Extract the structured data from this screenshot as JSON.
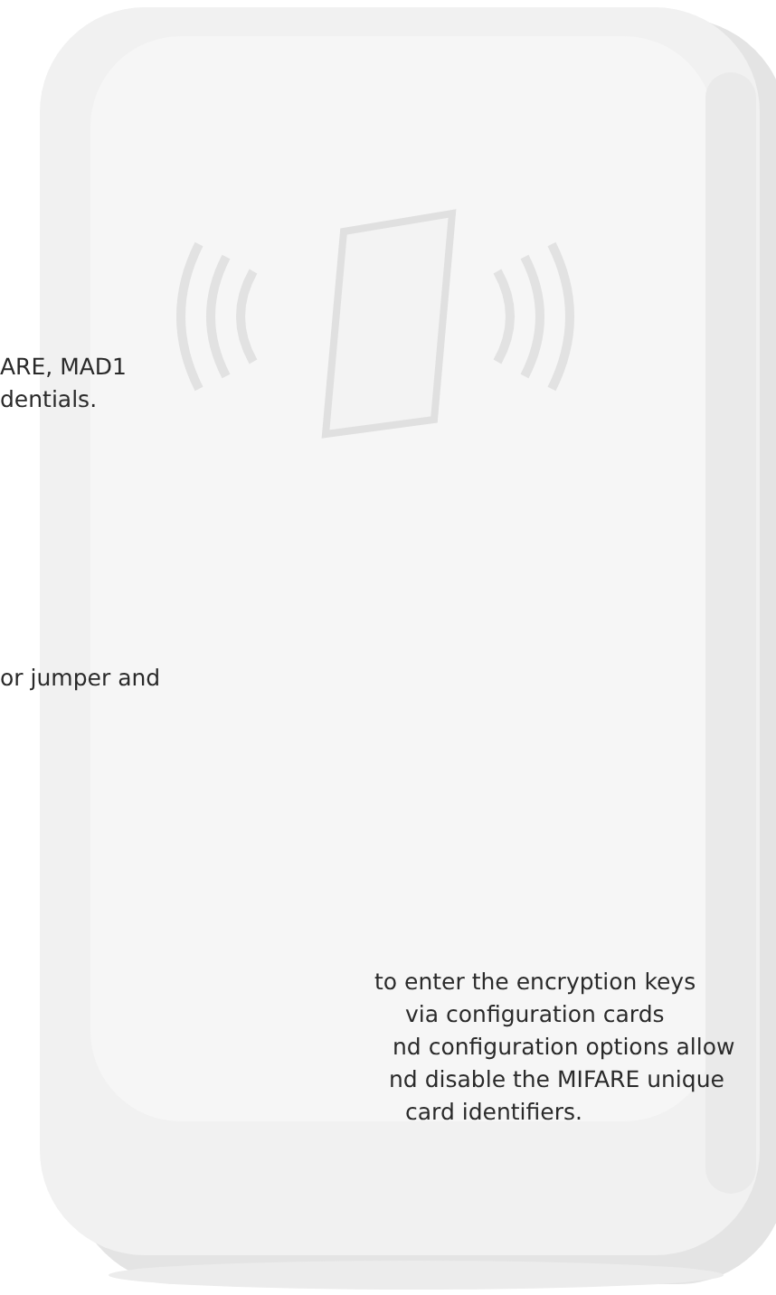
{
  "paragraphs": [
    {
      "lines": [
        "ARE, MAD1",
        "dentials."
      ]
    },
    {
      "lines": [
        "or jumper and"
      ]
    },
    {
      "lines": [
        "to enter the encryption keys",
        "via configuration cards",
        "nd configuration options allow",
        "nd disable the MIFARE unique",
        "card identifiers."
      ]
    }
  ]
}
